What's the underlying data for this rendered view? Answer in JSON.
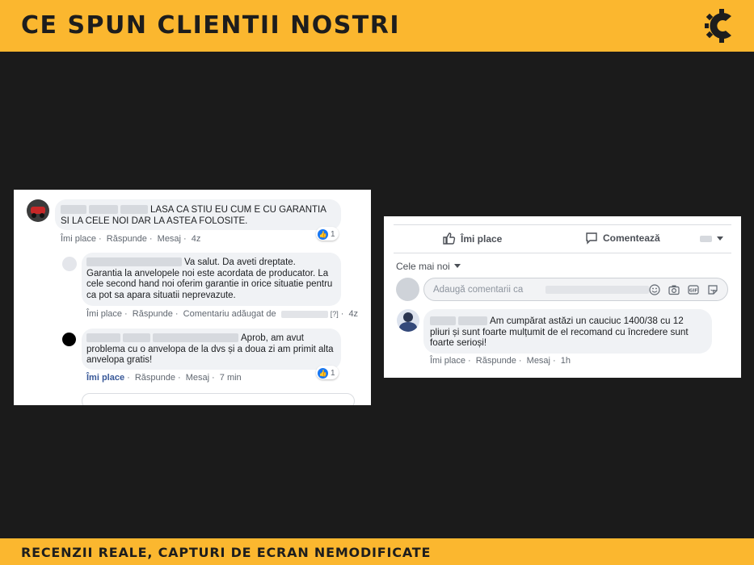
{
  "header": {
    "title": "CE SPUN CLIENTII NOSTRI"
  },
  "footer": {
    "tagline": "RECENZII REALE, CAPTURI DE ECRAN NEMODIFICATE"
  },
  "colors": {
    "brand": "#fbb72f",
    "background": "#1b1b1b",
    "facebook_blue": "#1877f2"
  },
  "screenshot1": {
    "comment1": {
      "text": "LASA CA STIU EU CUM E CU GARANTIA SI LA CELE NOI DAR LA ASTEA FOLOSITE.",
      "actions": [
        "Îmi place",
        "Răspunde",
        "Mesaj",
        "4z"
      ],
      "likes": "1"
    },
    "reply1": {
      "text": "Va salut. Da aveti dreptate. Garantia la anvelopele noi este acordata de producator. La cele second hand noi oferim garantie in orice situatie pentru ca pot sa apara situatii neprevazute.",
      "actions": [
        "Îmi place",
        "Răspunde",
        "Comentariu adăugat de"
      ],
      "marker": "[?]",
      "time": "4z"
    },
    "reply2": {
      "text": "Aprob, am avut problema cu o anvelopa de la dvs și a doua zi am primit alta anvelopa gratis!",
      "actions": [
        "Îmi place",
        "Răspunde",
        "Mesaj",
        "7 min"
      ],
      "likes": "1"
    }
  },
  "screenshot2": {
    "like_button": "Îmi place",
    "comment_button": "Comentează",
    "sort_label": "Cele mai noi",
    "input_placeholder": "Adaugă comentarii ca",
    "comment": {
      "text": "Am cumpărat astăzi un cauciuc 1400/38 cu 12 pliuri și sunt foarte mulțumit de el recomand cu încredere sunt foarte serioși!",
      "actions": [
        "Îmi place",
        "Răspunde",
        "Mesaj",
        "1h"
      ]
    }
  },
  "icons": [
    "logo-icon",
    "like-icon",
    "comment-icon",
    "emoji-icon",
    "camera-icon",
    "gif-icon",
    "sticker-icon",
    "chevron-down-icon"
  ]
}
